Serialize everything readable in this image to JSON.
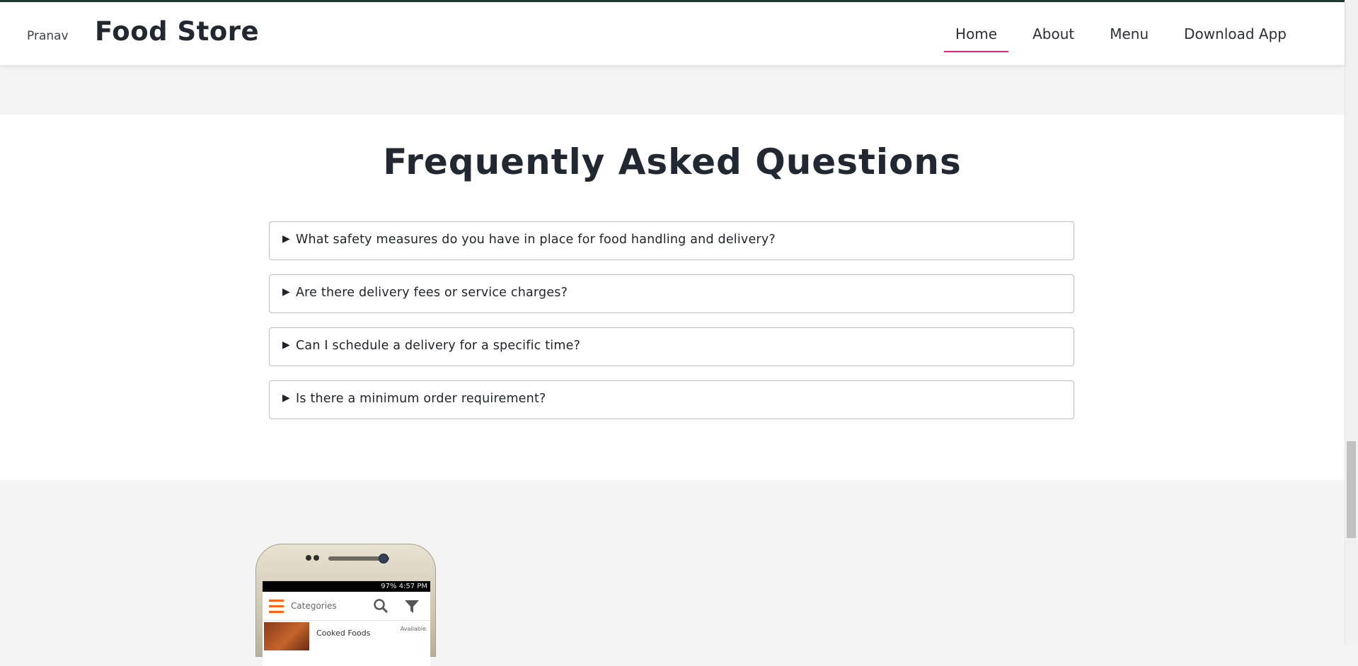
{
  "nav": {
    "user": "Pranav",
    "brand": "Food Store",
    "links": [
      "Home",
      "About",
      "Menu",
      "Download App"
    ],
    "active": "Home",
    "accent_color": "#e0247c"
  },
  "faq": {
    "title": "Frequently Asked Questions",
    "arrow": "▶",
    "questions": [
      "What safety measures do you have in place for food handling and delivery?",
      "Are there delivery fees or service charges?",
      "Can I schedule a delivery for a specific time?",
      "Is there a minimum order requirement?"
    ]
  },
  "phone": {
    "status": "97%  4:57 PM",
    "app_bar_title": "Categories",
    "item_name": "Cooked Foods",
    "item_status": "Available",
    "brand_color": "#f26b1d"
  }
}
